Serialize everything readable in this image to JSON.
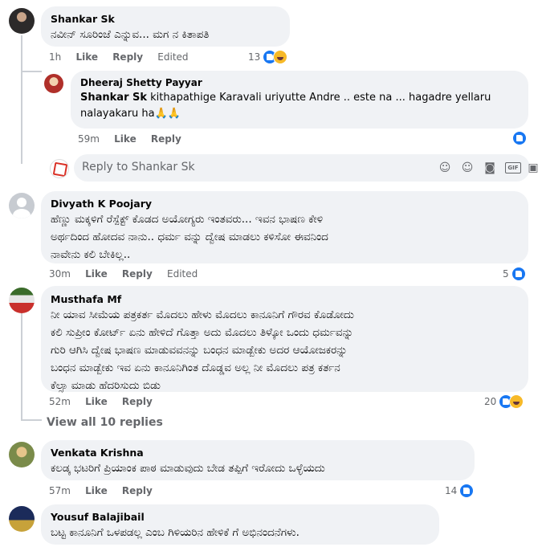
{
  "comments": [
    {
      "name": "Shankar Sk",
      "text": [
        "ನವೀನ್ ಸೂರಿಂಜೆ ಎನ್ನುವ... ಮಗ ನ ಕಿತಾಪತಿ"
      ],
      "time": "1h",
      "like": "Like",
      "reply": "Reply",
      "edited": "Edited",
      "count": "13"
    },
    {
      "name": "Dheeraj Shetty Payyar",
      "mention": "Shankar Sk",
      "text_line1": " kithapathige Karavali uriyutte Andre .. este na ... hagadre yellaru",
      "text_line2": "nalayakaru ha🙏🙏",
      "time": "59m",
      "like": "Like",
      "reply": "Reply"
    },
    {
      "name": "Divyath K Poojary",
      "text": [
        "ಹೆಣ್ಣು ಮಕ್ಕಳಿಗೆ ರೆಸ್ಪೆಕ್ಟ್ ಕೊಡದ ಅಯೋಗ್ಯರು ಇಂತವರು... ಇವನ ಭಾಷಣ ಕೇಳಿ",
        "ಅರ್ಥದಿಂದ ಹೋದವ ನಾನು.. ಧರ್ಮ ವನ್ನು ದ್ವೇಷ ಮಾಡಲು ಕಳಿಸೋ ಈವನಿಂದ",
        "ನಾವೇನು ಕಲಿ ಬೇಕಿಲ್ಲ.."
      ],
      "time": "30m",
      "like": "Like",
      "reply": "Reply",
      "edited": "Edited",
      "count": "5"
    },
    {
      "name": "Musthafa Mf",
      "text": [
        "ನೀ ಯಾವ ಸೀಮೆಯ ಪತ್ರಕರ್ತ ಮೊದಲು ಹೇಳು ಮೊದಲು ಕಾನೂನಿಗೆ ಗೌರವ ಕೊಡೋದು",
        "ಕಲಿ ಸುಪ್ರೀಂ ಕೋರ್ಟ್ ಏನು ಹೇಳಿದೆ ಗೊತ್ತಾ ಅದು ಮೊದಲು ತಿಳ್ಕೋ ಒಂದು ಧರ್ಮವನ್ನು",
        "ಗುರಿ ಆಗಿಸಿ ದ್ವೇಷ ಭಾಷಣ ಮಾಡುವವನನ್ನು ಬಂಧನ ಮಾಡ್ಬೇಕು ಅದರ ಆಯೋಜಕರನ್ನು",
        "ಬಂಧನ ಮಾಡ್ಬೇಕು ಇವ ಏನು ಕಾನೂನಿಗಿಂತ ದೊಡ್ಡವ ಅಲ್ಲ ನೀ ಮೊದಲು ಪತ್ರ ಕರ್ತನ",
        "ಕೆಲ್ಸಾ ಮಾಡು ಹೆದರಿಸುದು ಬಿಡು"
      ],
      "time": "52m",
      "like": "Like",
      "reply": "Reply",
      "count": "20"
    },
    {
      "name": "Venkata Krishna",
      "text": [
        "ಕಲಡ್ಕ ಭಟರಿಗೆ ಪ್ರಿಯಾಂಕ ಪಾಠ ಮಾಡುವುದು ಬೇಡ ತಪ್ಪಿಗೆ ಇರೋದು ಒಳ್ಳೆಯದು"
      ],
      "time": "57m",
      "like": "Like",
      "reply": "Reply",
      "count": "14"
    },
    {
      "name": "Yousuf Balajibail",
      "text": [
        "ಬಟ್ಟ ಕಾನೂನಿಗೆ ಒಳಪಡಲ್ಲ ಎಂಬ ಗಿಳಿಯರಿನ ಹೇಳಿಕೆ ಗೆ ಅಭಿನಂದನೆಗಳು."
      ]
    }
  ],
  "reply_box": {
    "placeholder": "Reply to Shankar Sk"
  },
  "view_replies": "View all 10 replies",
  "colors": {
    "like": "#1877f2",
    "haha": "#f7b928",
    "bubble": "#f0f2f5",
    "meta": "#65676b"
  }
}
